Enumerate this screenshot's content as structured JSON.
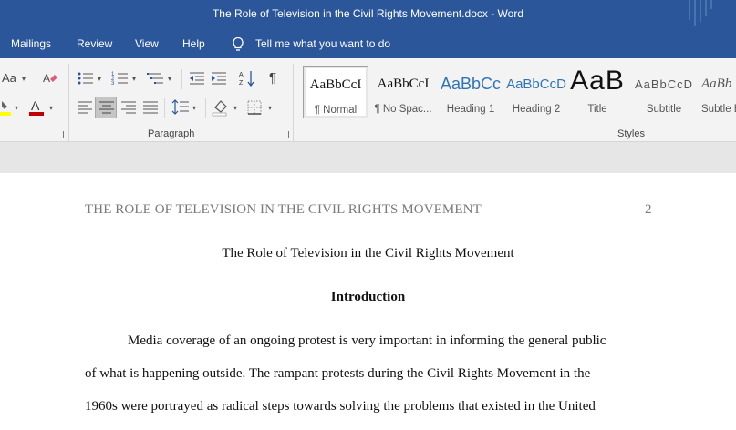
{
  "window": {
    "title": "The Role of Television in the Civil Rights Movement.docx  -  Word"
  },
  "menu": {
    "tabs": [
      "Mailings",
      "Review",
      "View",
      "Help"
    ],
    "tell_me": "Tell me what you want to do"
  },
  "ribbon": {
    "font_aa_label": "Aa",
    "paragraph_group_label": "Paragraph",
    "styles_group_label": "Styles",
    "styles": [
      {
        "sample": "AaBbCcI",
        "name": "¶ Normal",
        "selected": true
      },
      {
        "sample": "AaBbCcI",
        "name": "¶ No Spac..."
      },
      {
        "sample": "AaBbCc",
        "name": "Heading 1"
      },
      {
        "sample": "AaBbCcD",
        "name": "Heading 2"
      },
      {
        "sample": "AaB",
        "name": "Title"
      },
      {
        "sample": "AaBbCcD",
        "name": "Subtitle"
      },
      {
        "sample": "AaBb",
        "name": "Subtle E..."
      }
    ],
    "colors": {
      "font_color": "#c00000",
      "highlight": "#ffff00"
    }
  },
  "document": {
    "running_head": "THE ROLE OF TELEVISION IN THE CIVIL RIGHTS MOVEMENT",
    "page_number": "2",
    "title": "The Role of Television in the Civil Rights Movement",
    "heading": "Introduction",
    "paragraph_lines": [
      "Media coverage of an ongoing protest is very important in informing the general public",
      "of what is happening outside. The rampant protests during the Civil Rights Movement in the",
      "1960s were portrayed as radical steps towards solving the problems that existed in the United"
    ]
  }
}
